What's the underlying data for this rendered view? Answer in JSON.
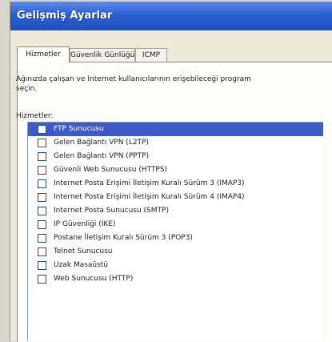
{
  "window": {
    "title": "Gelişmiş Ayarlar"
  },
  "tabs": [
    {
      "label": "Hizmetler",
      "active": true
    },
    {
      "label": "Güvenlik Günlüğü",
      "active": false
    },
    {
      "label": "ICMP",
      "active": false
    }
  ],
  "description": {
    "line1": "Ağınızda çalışan ve Internet kullanıcılarının erişebileceği program",
    "line2": "seçin."
  },
  "services_label": "Hizmetler:",
  "services": [
    {
      "label": "FTP Sunucusu",
      "checked": false,
      "selected": true
    },
    {
      "label": "Gelen Bağlantı VPN (L2TP)",
      "checked": false,
      "selected": false
    },
    {
      "label": "Gelen Bağlantı VPN (PPTP)",
      "checked": false,
      "selected": false
    },
    {
      "label": "Güvenli Web Sunucusu (HTTPS)",
      "checked": false,
      "selected": false
    },
    {
      "label": "Internet Posta Erişimi İletişim Kuralı Sürüm 3 (IMAP3)",
      "checked": false,
      "selected": false
    },
    {
      "label": "Internet Posta Erişimi İletişim Kuralı Sürüm 4 (IMAP4)",
      "checked": false,
      "selected": false
    },
    {
      "label": "Internet Posta Sunucusu (SMTP)",
      "checked": false,
      "selected": false
    },
    {
      "label": "IP Güvenliği (IKE)",
      "checked": false,
      "selected": false
    },
    {
      "label": "Postane İletişim Kuralı Sürüm 3 (POP3)",
      "checked": false,
      "selected": false
    },
    {
      "label": "Telnet Sunucusu",
      "checked": false,
      "selected": false
    },
    {
      "label": "Uzak Masaüstü",
      "checked": false,
      "selected": false
    },
    {
      "label": "Web Sunucusu (HTTP)",
      "checked": false,
      "selected": false
    }
  ],
  "colors": {
    "titlebar": "#2b5fd1",
    "selection": "#3d5bc8",
    "dialog_bg": "#ece9d8"
  }
}
